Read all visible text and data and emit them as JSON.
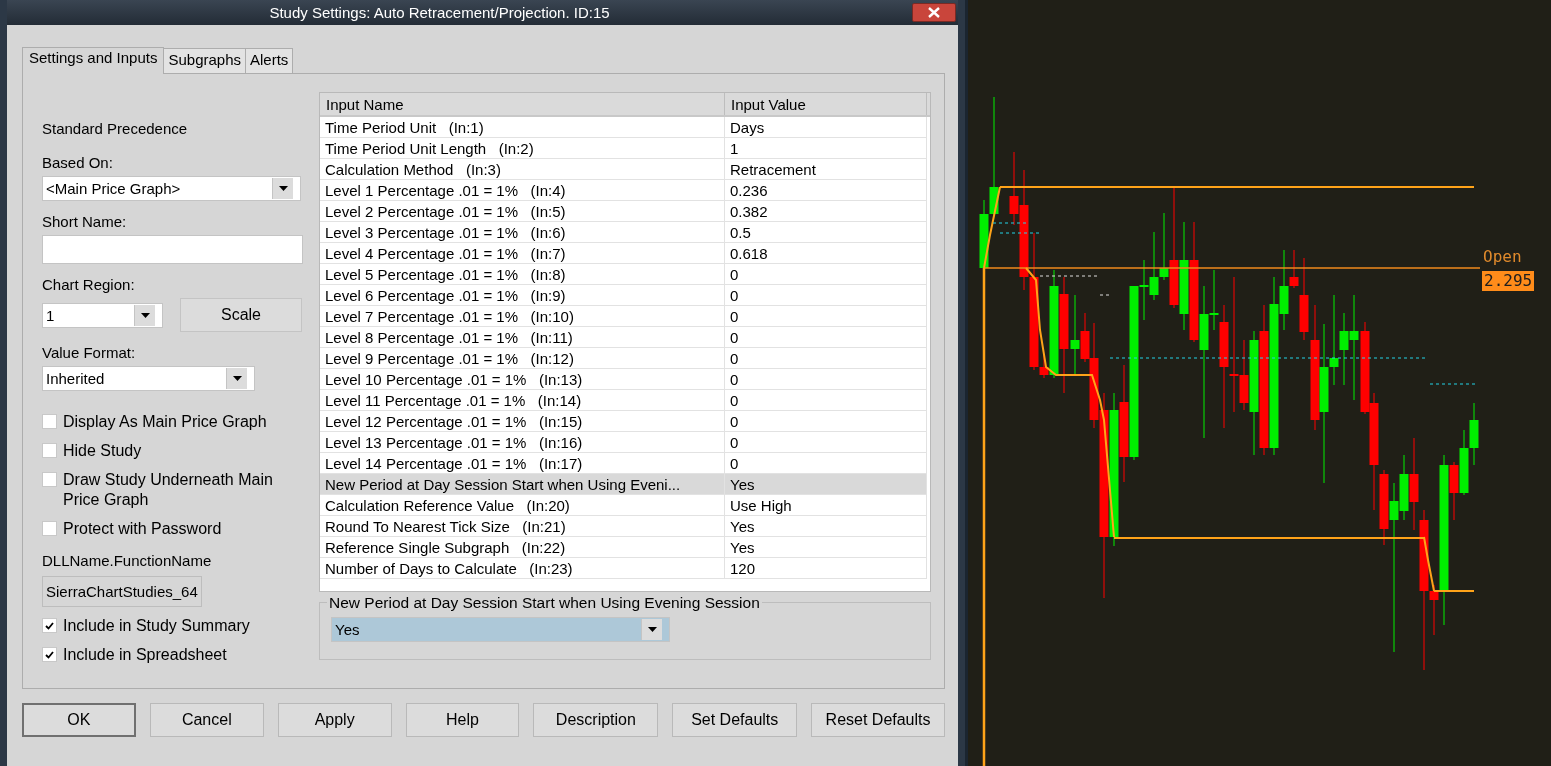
{
  "window": {
    "title": "Study Settings: Auto Retracement/Projection. ID:15"
  },
  "tabs": [
    {
      "label": "Settings and Inputs",
      "selected": true
    },
    {
      "label": "Subgraphs",
      "selected": false
    },
    {
      "label": "Alerts",
      "selected": false
    }
  ],
  "settings": {
    "precedence": "Standard Precedence",
    "based_on": {
      "label": "Based On:",
      "value": "<Main Price Graph>"
    },
    "short_name": {
      "label": "Short Name:"
    },
    "chart_region": {
      "label": "Chart Region:",
      "value": "1"
    },
    "scale_button": "Scale",
    "value_format": {
      "label": "Value Format:",
      "value": "Inherited"
    },
    "options": [
      {
        "label": "Display As Main Price Graph",
        "checked": false
      },
      {
        "label": "Hide Study",
        "checked": false
      },
      {
        "label": "Draw Study Underneath Main Price Graph",
        "checked": false
      },
      {
        "label": "Protect with Password",
        "checked": false
      }
    ],
    "dll": {
      "label": "DLLName.FunctionName",
      "value": "SierraChartStudies_64"
    },
    "includes": [
      {
        "label": "Include in Study Summary",
        "checked": true
      },
      {
        "label": "Include in Spreadsheet",
        "checked": true
      }
    ]
  },
  "inputs_table": {
    "columns": [
      "Input Name",
      "Input Value"
    ],
    "rows": [
      {
        "name": "Time Period Unit   (In:1)",
        "value": "Days",
        "selected": false
      },
      {
        "name": "Time Period Unit Length   (In:2)",
        "value": "1",
        "selected": false
      },
      {
        "name": "Calculation Method   (In:3)",
        "value": "Retracement",
        "selected": false
      },
      {
        "name": "Level 1 Percentage .01 = 1%   (In:4)",
        "value": "0.236",
        "selected": false
      },
      {
        "name": "Level 2 Percentage .01 = 1%   (In:5)",
        "value": "0.382",
        "selected": false
      },
      {
        "name": "Level 3 Percentage .01 = 1%   (In:6)",
        "value": "0.5",
        "selected": false
      },
      {
        "name": "Level 4 Percentage .01 = 1%   (In:7)",
        "value": "0.618",
        "selected": false
      },
      {
        "name": "Level 5 Percentage .01 = 1%   (In:8)",
        "value": "0",
        "selected": false
      },
      {
        "name": "Level 6 Percentage .01 = 1%   (In:9)",
        "value": "0",
        "selected": false
      },
      {
        "name": "Level 7 Percentage .01 = 1%   (In:10)",
        "value": "0",
        "selected": false
      },
      {
        "name": "Level 8 Percentage .01 = 1%   (In:11)",
        "value": "0",
        "selected": false
      },
      {
        "name": "Level 9 Percentage .01 = 1%   (In:12)",
        "value": "0",
        "selected": false
      },
      {
        "name": "Level 10 Percentage .01 = 1%   (In:13)",
        "value": "0",
        "selected": false
      },
      {
        "name": "Level 11 Percentage .01 = 1%   (In:14)",
        "value": "0",
        "selected": false
      },
      {
        "name": "Level 12 Percentage .01 = 1%   (In:15)",
        "value": "0",
        "selected": false
      },
      {
        "name": "Level 13 Percentage .01 = 1%   (In:16)",
        "value": "0",
        "selected": false
      },
      {
        "name": "Level 14 Percentage .01 = 1%   (In:17)",
        "value": "0",
        "selected": false
      },
      {
        "name": "New Period at Day Session Start when Using Eveni...",
        "value": "Yes",
        "selected": true
      },
      {
        "name": "Calculation Reference Value   (In:20)",
        "value": "Use High",
        "selected": false
      },
      {
        "name": "Round To Nearest Tick Size   (In:21)",
        "value": "Yes",
        "selected": false
      },
      {
        "name": "Reference Single Subgraph   (In:22)",
        "value": "Yes",
        "selected": false
      },
      {
        "name": "Number of Days to Calculate   (In:23)",
        "value": "120",
        "selected": false
      }
    ]
  },
  "editor": {
    "label": "New Period at Day Session Start when Using Evening Session",
    "value": "Yes"
  },
  "buttons": [
    {
      "label": "OK",
      "default": true
    },
    {
      "label": "Cancel",
      "default": false
    },
    {
      "label": "Apply",
      "default": false
    },
    {
      "label": "Help",
      "default": false
    },
    {
      "label": "Description",
      "default": false
    },
    {
      "label": "Set Defaults",
      "default": false
    },
    {
      "label": "Reset Defaults",
      "default": false
    }
  ],
  "chart": {
    "line_label": "Open",
    "price": "2.295"
  }
}
